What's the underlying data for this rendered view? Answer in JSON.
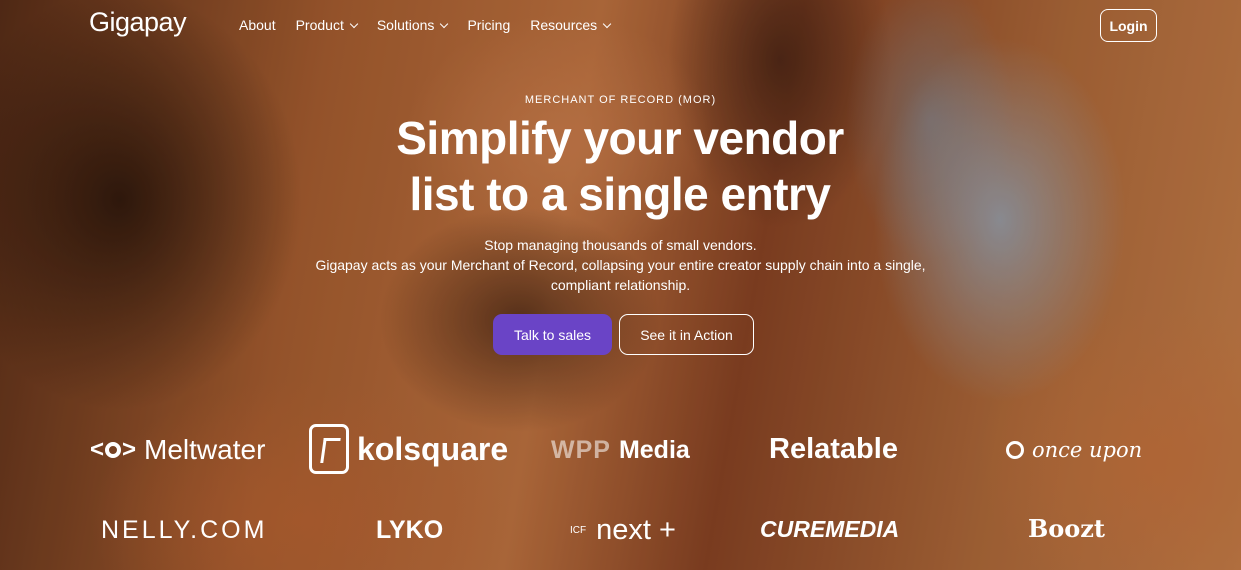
{
  "nav": {
    "logo": "Gigapay",
    "items": [
      {
        "label": "About"
      },
      {
        "label": "Product"
      },
      {
        "label": "Solutions"
      },
      {
        "label": "Pricing"
      },
      {
        "label": "Resources"
      }
    ],
    "login_label": "Login"
  },
  "hero": {
    "eyebrow": "MERCHANT OF RECORD (MOR)",
    "headline_line1": "Simplify your vendor",
    "headline_line2": "list to a single entry",
    "sub_line1": "Stop managing thousands of small vendors.",
    "sub_line2": "Gigapay acts as your Merchant of Record, collapsing your entire creator supply chain into a single,",
    "sub_line3": "compliant relationship.",
    "primary_cta": "Talk to sales",
    "secondary_cta": "See it in Action"
  },
  "logos": {
    "meltwater": "Meltwater",
    "kolsquare": "kolsquare",
    "wpp_prefix": "WPP",
    "wpp_suffix": "Media",
    "relatable": "Relatable",
    "onceupon": "once upon",
    "nelly": "NELLY.COM",
    "lyko": "LYKO",
    "icf_prefix": "ICF",
    "icf_main": "next",
    "curemedia": "CUREMEDIA",
    "boozt": "Boozt"
  },
  "colors": {
    "primary_button": "#6a44c6",
    "text": "#ffffff"
  }
}
